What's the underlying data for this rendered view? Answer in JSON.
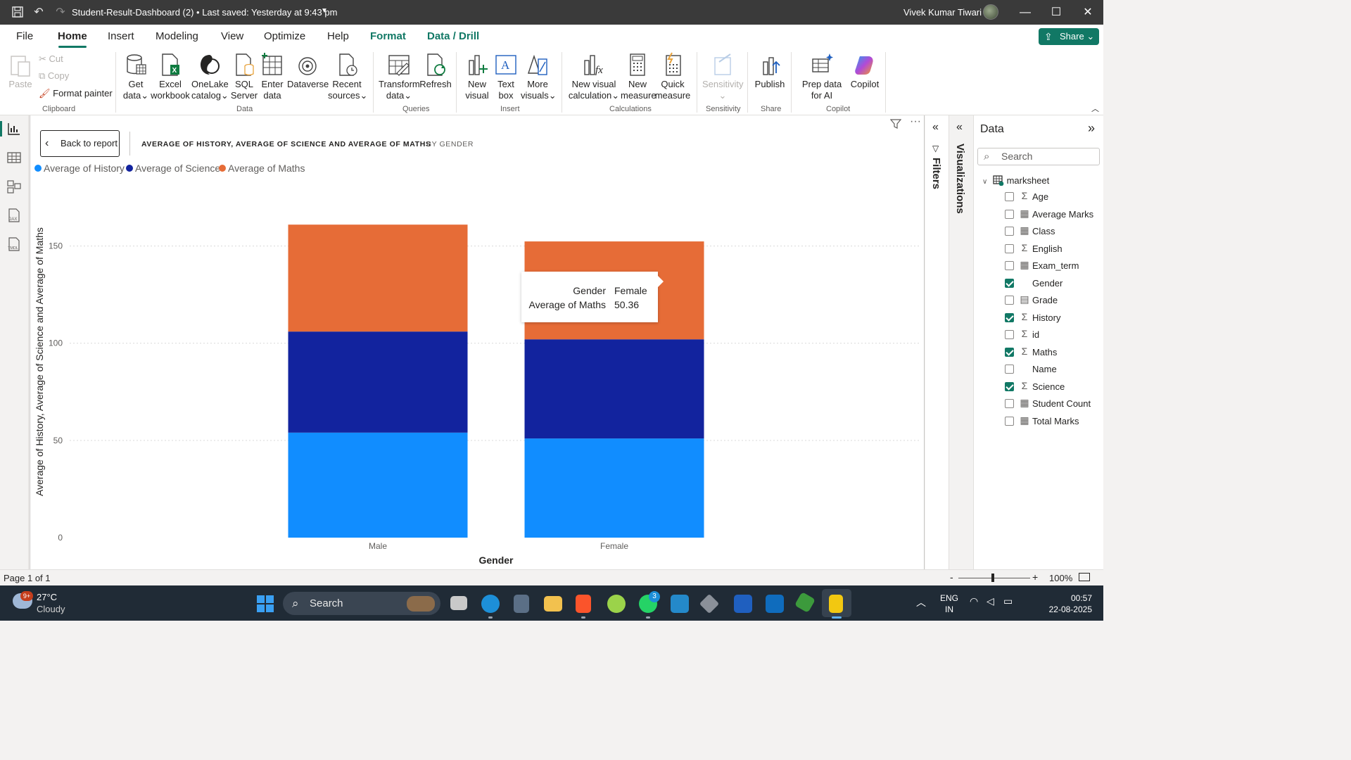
{
  "titlebar": {
    "doc_title": "Student-Result-Dashboard (2) • Last saved: Yesterday at 9:43 pm",
    "user_name": "Vivek Kumar Tiwari"
  },
  "tabs": [
    {
      "label": "File"
    },
    {
      "label": "Home"
    },
    {
      "label": "Insert"
    },
    {
      "label": "Modeling"
    },
    {
      "label": "View"
    },
    {
      "label": "Optimize"
    },
    {
      "label": "Help"
    },
    {
      "label": "Format"
    },
    {
      "label": "Data / Drill"
    }
  ],
  "share_label": "Share",
  "ribbon": {
    "clipboard": {
      "paste": "Paste",
      "cut": "Cut",
      "copy": "Copy",
      "format_painter": "Format painter",
      "group": "Clipboard"
    },
    "data": {
      "get_data": "Get data",
      "excel": "Excel workbook",
      "onelake": "OneLake catalog",
      "sql": "SQL Server",
      "enter": "Enter data",
      "dataverse": "Dataverse",
      "recent": "Recent sources",
      "group": "Data"
    },
    "queries": {
      "transform": "Transform data",
      "refresh": "Refresh",
      "group": "Queries"
    },
    "insert": {
      "new_visual": "New visual",
      "text_box": "Text box",
      "more_visuals": "More visuals",
      "group": "Insert"
    },
    "calculations": {
      "new_visual_calc": "New visual calculation",
      "new_measure": "New measure",
      "quick_measure": "Quick measure",
      "group": "Calculations"
    },
    "sensitivity": {
      "label": "Sensitivity",
      "group": "Sensitivity"
    },
    "share": {
      "publish": "Publish",
      "group": "Share"
    },
    "copilot": {
      "prep": "Prep data for AI",
      "copilot": "Copilot",
      "group": "Copilot"
    }
  },
  "canvas": {
    "back_label": "Back to report",
    "visual_title": "AVERAGE OF HISTORY, AVERAGE OF SCIENCE AND AVERAGE OF MATHS",
    "visual_subtitle": "BY GENDER"
  },
  "chart_data": {
    "type": "bar",
    "stacked": true,
    "categories": [
      "Male",
      "Female"
    ],
    "series": [
      {
        "name": "Average of History",
        "color": "#118dff",
        "values": [
          54,
          51
        ]
      },
      {
        "name": "Average of Science",
        "color": "#12239e",
        "values": [
          52,
          51
        ]
      },
      {
        "name": "Average of Maths",
        "color": "#e66c37",
        "values": [
          55,
          50.36
        ]
      }
    ],
    "xlabel": "Gender",
    "ylabel": "Average of History, Average of Science and Average of Maths",
    "ylim": [
      0,
      165
    ],
    "yticks": [
      "0",
      "50",
      "100",
      "150"
    ],
    "legend": "top-left",
    "grid": true
  },
  "tooltip": {
    "label1": "Gender",
    "value1": "Female",
    "label2": "Average of Maths",
    "value2": "50.36"
  },
  "panes": {
    "filters": "Filters",
    "visualizations": "Visualizations",
    "data_title": "Data",
    "search_placeholder": "Search",
    "table_name": "marksheet",
    "fields": [
      {
        "name": "Age",
        "type": "sigma",
        "checked": false
      },
      {
        "name": "Average Marks",
        "type": "calc",
        "checked": false
      },
      {
        "name": "Class",
        "type": "calc",
        "checked": false
      },
      {
        "name": "English",
        "type": "sigma",
        "checked": false
      },
      {
        "name": "Exam_term",
        "type": "calc",
        "checked": false
      },
      {
        "name": "Gender",
        "type": "none",
        "checked": true
      },
      {
        "name": "Grade",
        "type": "calc2",
        "checked": false
      },
      {
        "name": "History",
        "type": "sigma",
        "checked": true
      },
      {
        "name": "id",
        "type": "sigma",
        "checked": false
      },
      {
        "name": "Maths",
        "type": "sigma",
        "checked": true
      },
      {
        "name": "Name",
        "type": "none",
        "checked": false
      },
      {
        "name": "Science",
        "type": "sigma",
        "checked": true
      },
      {
        "name": "Student Count",
        "type": "calc",
        "checked": false
      },
      {
        "name": "Total Marks",
        "type": "calc",
        "checked": false
      }
    ]
  },
  "statusbar": {
    "page": "Page 1 of 1",
    "zoom": "100%"
  },
  "taskbar": {
    "temp": "27°C",
    "weather": "Cloudy",
    "weather_badge": "9+",
    "search": "Search",
    "whatsapp_badge": "3",
    "lang1": "ENG",
    "lang2": "IN",
    "time": "00:57",
    "date": "22-08-2025"
  }
}
